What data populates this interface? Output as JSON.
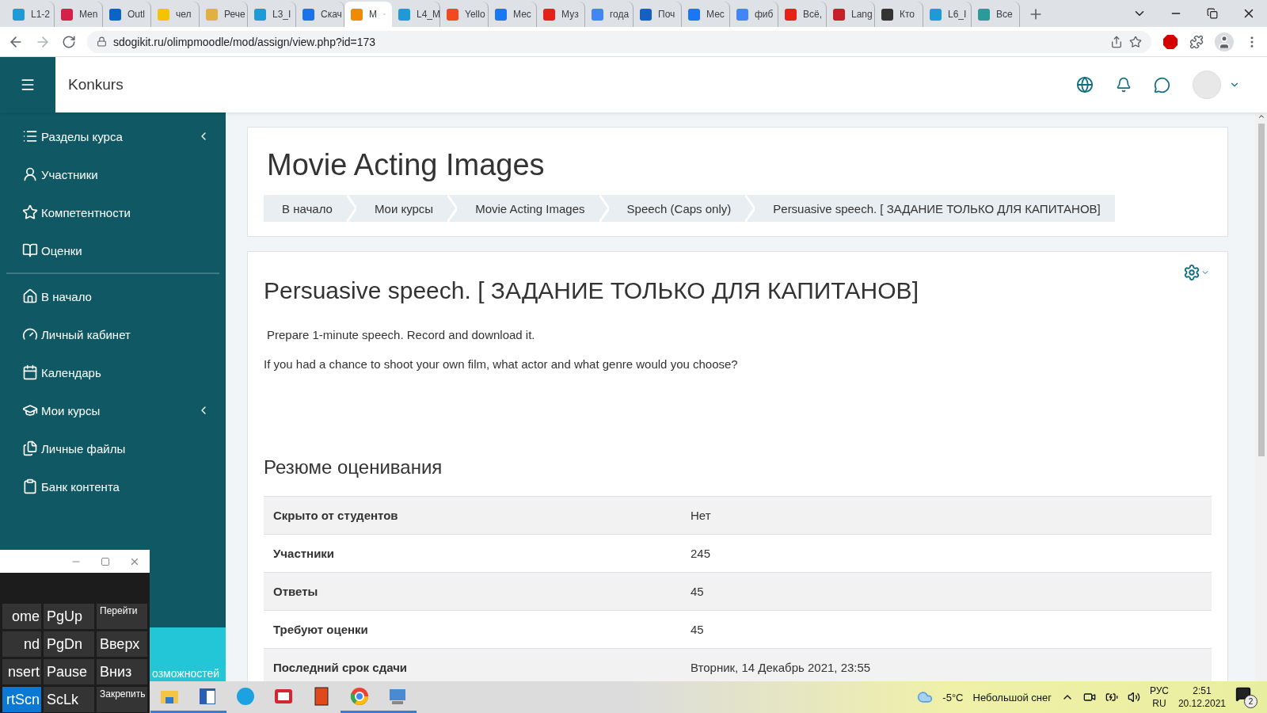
{
  "browser": {
    "tabs": [
      {
        "label": "L1-2",
        "selected": false,
        "color": "#1e9bd7"
      },
      {
        "label": "Men",
        "selected": false,
        "color": "#d6204a"
      },
      {
        "label": "Outl",
        "selected": false,
        "color": "#0a64c8"
      },
      {
        "label": "чел",
        "selected": false,
        "color": "#f5c400"
      },
      {
        "label": "Рече",
        "selected": false,
        "color": "#e0b040"
      },
      {
        "label": "L3_I",
        "selected": false,
        "color": "#1e9bd7"
      },
      {
        "label": "Скач",
        "selected": false,
        "color": "#1a73e8"
      },
      {
        "label": "M",
        "selected": true,
        "color": "#f08a00"
      },
      {
        "label": "L4_M",
        "selected": false,
        "color": "#1e9bd7"
      },
      {
        "label": "Yello",
        "selected": false,
        "color": "#f04a1e"
      },
      {
        "label": "Мес",
        "selected": false,
        "color": "#1877f2"
      },
      {
        "label": "Муз",
        "selected": false,
        "color": "#e62117"
      },
      {
        "label": "года",
        "selected": false,
        "color": "#4285f4"
      },
      {
        "label": "Поч",
        "selected": false,
        "color": "#1560c0"
      },
      {
        "label": "Мес",
        "selected": false,
        "color": "#1877f2"
      },
      {
        "label": "фиб",
        "selected": false,
        "color": "#4285f4"
      },
      {
        "label": "Всё,",
        "selected": false,
        "color": "#e62117"
      },
      {
        "label": "Lang",
        "selected": false,
        "color": "#c8202a"
      },
      {
        "label": "Кто",
        "selected": false,
        "color": "#333333"
      },
      {
        "label": "L6_I",
        "selected": false,
        "color": "#1e9bd7"
      },
      {
        "label": "Все",
        "selected": false,
        "color": "#2a9a9a"
      }
    ],
    "address": "sdogikit.ru/olimpmoodle/mod/assign/view.php?id=173"
  },
  "site": {
    "name": "Konkurs"
  },
  "sidebar": {
    "groups": [
      [
        {
          "label": "Разделы курса",
          "expandable": true
        },
        {
          "label": "Участники",
          "expandable": false
        },
        {
          "label": "Компетентности",
          "expandable": false
        },
        {
          "label": "Оценки",
          "expandable": false
        }
      ],
      [
        {
          "label": "В начало",
          "expandable": false
        },
        {
          "label": "Личный кабинет",
          "expandable": false
        },
        {
          "label": "Календарь",
          "expandable": false
        },
        {
          "label": "Мои курсы",
          "expandable": true
        },
        {
          "label": "Личные файлы",
          "expandable": false
        },
        {
          "label": "Банк контента",
          "expandable": false
        }
      ]
    ],
    "footer": "озможностей"
  },
  "page": {
    "heading": "Movie Acting Images",
    "breadcrumb": [
      "В начало",
      "Мои курсы",
      "Movie Acting Images",
      "Speech (Caps only)",
      "Persuasive speech. [ ЗАДАНИЕ ТОЛЬКО ДЛЯ КАПИТАНОВ]"
    ]
  },
  "assignment": {
    "title": "Persuasive speech. [ ЗАДАНИЕ ТОЛЬКО ДЛЯ КАПИТАНОВ]",
    "paragraphs": [
      "Prepare 1-minute speech. Record and download it.",
      "If you had a chance to shoot your own film, what actor and what genre would you choose?"
    ],
    "summary_title": "Резюме оценивания",
    "rows": [
      {
        "label": "Скрыто от студентов",
        "value": "Нет"
      },
      {
        "label": "Участники",
        "value": "245"
      },
      {
        "label": "Ответы",
        "value": "45"
      },
      {
        "label": "Требуют оценки",
        "value": "45"
      },
      {
        "label": "Последний срок сдачи",
        "value": "Вторник, 14 Декабрь 2021, 23:55"
      }
    ]
  },
  "keyboard": {
    "rows": [
      [
        {
          "label": "ome",
          "selected": false
        },
        {
          "label": "PgUp",
          "selected": false
        },
        {
          "label": "Перейти",
          "selected": false,
          "kind": "small"
        }
      ],
      [
        {
          "label": "nd",
          "selected": false
        },
        {
          "label": "PgDn",
          "selected": false
        },
        {
          "label": "Вверх",
          "selected": false,
          "kind": "key"
        }
      ],
      [
        {
          "label": "nsert",
          "selected": false
        },
        {
          "label": "Pause",
          "selected": false
        },
        {
          "label": "Вниз",
          "selected": false,
          "kind": "key"
        }
      ],
      [
        {
          "label": "rtScn",
          "selected": true
        },
        {
          "label": "ScLk",
          "selected": false
        },
        {
          "label": "Закрепить",
          "selected": false,
          "kind": "small"
        }
      ]
    ]
  },
  "taskbar": {
    "apps": [
      {
        "running": true
      },
      {
        "running": true
      },
      {
        "running": false
      },
      {
        "running": false
      },
      {
        "running": false
      },
      {
        "running": true
      },
      {
        "running": true
      }
    ]
  },
  "tray": {
    "temperature": "-5°C",
    "weather": "Небольшой снег",
    "language": "РУС",
    "region": "RU",
    "time": "2:51",
    "date": "20.12.2021",
    "notifications": "2"
  }
}
